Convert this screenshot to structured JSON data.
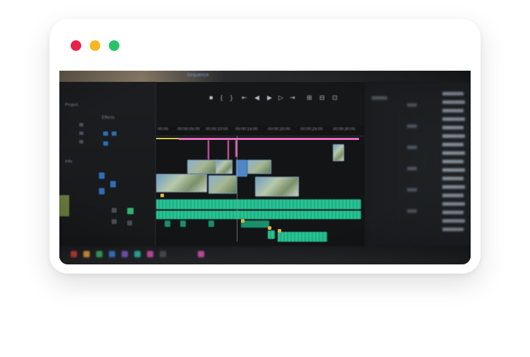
{
  "window": {
    "controls": [
      {
        "name": "close",
        "color": "#e8224a"
      },
      {
        "name": "minimize",
        "color": "#f6b81c"
      },
      {
        "name": "maximize",
        "color": "#27c36a"
      }
    ]
  },
  "editor": {
    "header_tab": "Sequence",
    "ruler_ticks": [
      "00:00",
      "00:00:05:00",
      "00:00:10:00",
      "00:00:15:00",
      "00:00:20:00",
      "00:00:25:00",
      "00:00:30:00"
    ],
    "playback_glyphs": [
      "■",
      "{",
      "}",
      "⇤",
      "◀",
      "▶",
      "▷",
      "⇥",
      "⊞",
      "⊟",
      "⊡"
    ],
    "panel_labels": [
      "Project",
      "Effects",
      "Info"
    ]
  },
  "colors": {
    "accent_pink": "#e96cc0",
    "audio_green": "#27c796",
    "video_blue": "#4f86c6",
    "marker_yellow": "#e7b23a"
  }
}
